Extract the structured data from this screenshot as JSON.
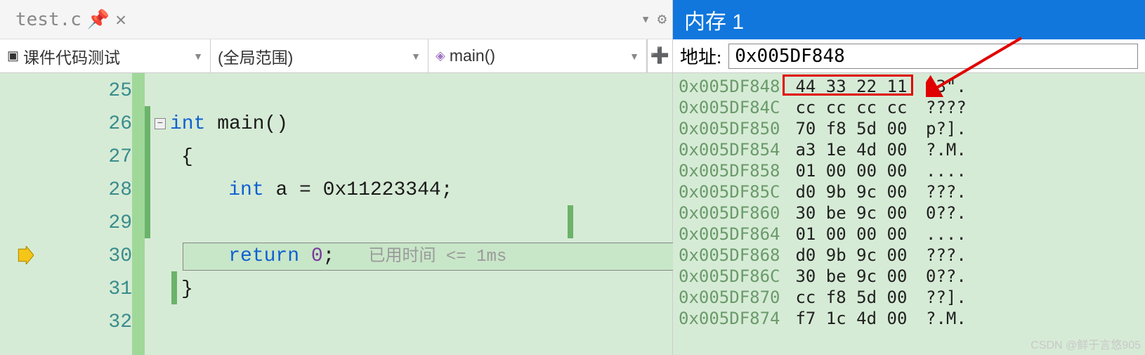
{
  "editor": {
    "tab": {
      "filename": "test.c",
      "pin_icon": "pin-icon",
      "close_icon": "close-icon"
    },
    "dropdowns": {
      "project": "课件代码测试",
      "scope": "(全局范围)",
      "function": "main()"
    },
    "line_numbers": [
      "25",
      "26",
      "27",
      "28",
      "29",
      "30",
      "31",
      "32"
    ],
    "code": {
      "l26_kw": "int",
      "l26_rest": " main()",
      "l27": "{",
      "l28_kw": "int",
      "l28_mid": " a = ",
      "l28_lit": "0x11223344",
      "l28_end": ";",
      "l30_kw": "return",
      "l30_mid": " ",
      "l30_lit": "0",
      "l30_end": ";",
      "l30_hint": " 已用时间 <= 1ms",
      "l31": "}"
    },
    "current_exec_line": 30
  },
  "memory": {
    "title": "内存 1",
    "addr_label": "地址:",
    "addr_value": "0x005DF848",
    "rows": [
      {
        "addr": "0x005DF848",
        "bytes": "44 33 22 11",
        "ascii": "D3\"."
      },
      {
        "addr": "0x005DF84C",
        "bytes": "cc cc cc cc",
        "ascii": "????"
      },
      {
        "addr": "0x005DF850",
        "bytes": "70 f8 5d 00",
        "ascii": "p?]."
      },
      {
        "addr": "0x005DF854",
        "bytes": "a3 1e 4d 00",
        "ascii": "?.M."
      },
      {
        "addr": "0x005DF858",
        "bytes": "01 00 00 00",
        "ascii": "...."
      },
      {
        "addr": "0x005DF85C",
        "bytes": "d0 9b 9c 00",
        "ascii": "???."
      },
      {
        "addr": "0x005DF860",
        "bytes": "30 be 9c 00",
        "ascii": "0??."
      },
      {
        "addr": "0x005DF864",
        "bytes": "01 00 00 00",
        "ascii": "...."
      },
      {
        "addr": "0x005DF868",
        "bytes": "d0 9b 9c 00",
        "ascii": "???."
      },
      {
        "addr": "0x005DF86C",
        "bytes": "30 be 9c 00",
        "ascii": "0??."
      },
      {
        "addr": "0x005DF870",
        "bytes": "cc f8 5d 00",
        "ascii": "??]."
      },
      {
        "addr": "0x005DF874",
        "bytes": "f7 1c 4d 00",
        "ascii": "?.M."
      }
    ],
    "highlight_row_index": 0
  },
  "watermark": "CSDN @鲜于言悠905"
}
